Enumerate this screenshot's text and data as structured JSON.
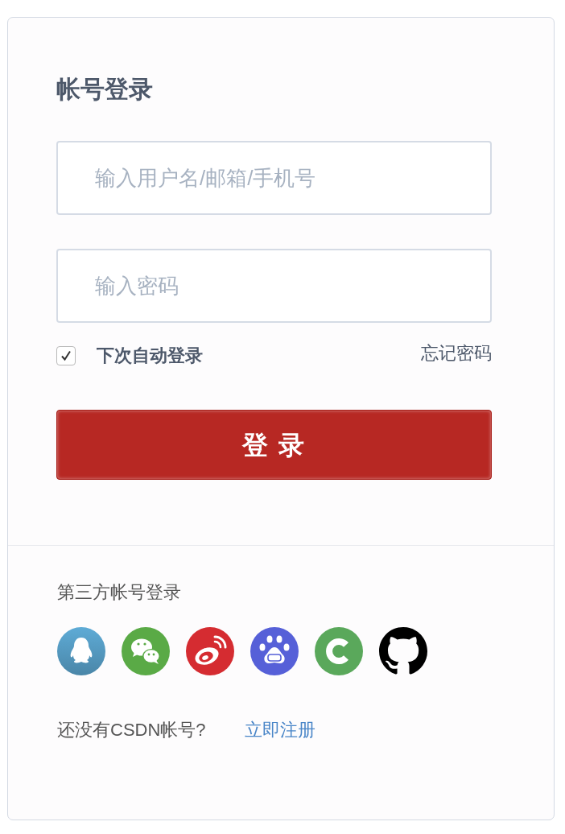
{
  "login": {
    "title": "帐号登录",
    "fields": [
      {
        "placeholder": "输入用户名/邮箱/手机号"
      },
      {
        "placeholder": "输入密码"
      }
    ],
    "remember": {
      "label": "下次自动登录",
      "checked": true
    },
    "forgot_link": "忘记密码",
    "submit_button": "登 录"
  },
  "third_party": {
    "title": "第三方帐号登录",
    "providers": [
      {
        "kind": "penguin"
      },
      {
        "kind": "chat"
      },
      {
        "kind": "eye"
      },
      {
        "kind": "paw"
      },
      {
        "kind": "c"
      },
      {
        "kind": "cat"
      }
    ]
  },
  "signup": {
    "prompt": "还没有CSDN帐号?",
    "link": "立即注册"
  }
}
